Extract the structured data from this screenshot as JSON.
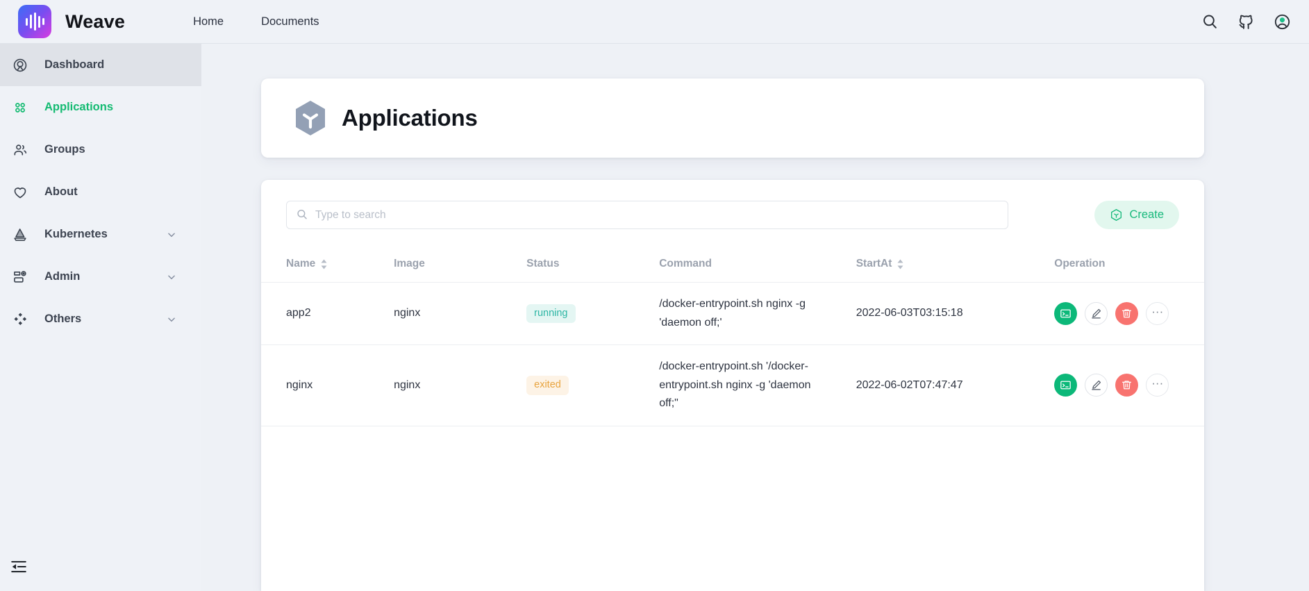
{
  "brand": {
    "name": "Weave",
    "logo_icon": "waveform-logo-icon"
  },
  "topnav": {
    "items": [
      {
        "label": "Home",
        "name": "home"
      },
      {
        "label": "Documents",
        "name": "documents"
      }
    ]
  },
  "top_icons": [
    {
      "name": "search-icon"
    },
    {
      "name": "github-icon"
    },
    {
      "name": "account-icon"
    }
  ],
  "sidebar": {
    "items": [
      {
        "label": "Dashboard",
        "icon": "dashboard-icon",
        "state": "active",
        "chevron": false
      },
      {
        "label": "Applications",
        "icon": "grid-icon",
        "state": "selected",
        "chevron": false
      },
      {
        "label": "Groups",
        "icon": "users-icon",
        "state": "normal",
        "chevron": false
      },
      {
        "label": "About",
        "icon": "heart-icon",
        "state": "normal",
        "chevron": false
      },
      {
        "label": "Kubernetes",
        "icon": "sailboat-icon",
        "state": "normal",
        "chevron": true
      },
      {
        "label": "Admin",
        "icon": "server-icon",
        "state": "normal",
        "chevron": true
      },
      {
        "label": "Others",
        "icon": "diamonds-icon",
        "state": "normal",
        "chevron": true
      }
    ],
    "collapse_icon": "menu-fold-icon"
  },
  "page": {
    "title": "Applications",
    "icon": "hexagon-cube-icon"
  },
  "search": {
    "placeholder": "Type to search",
    "value": "",
    "icon": "search-icon"
  },
  "create": {
    "label": "Create",
    "icon": "hexagon-plus-icon"
  },
  "table": {
    "columns": [
      {
        "label": "Name",
        "sortable": true
      },
      {
        "label": "Image",
        "sortable": false
      },
      {
        "label": "Status",
        "sortable": false
      },
      {
        "label": "Command",
        "sortable": false
      },
      {
        "label": "StartAt",
        "sortable": true
      },
      {
        "label": "Operation",
        "sortable": false
      }
    ],
    "rows": [
      {
        "name": "app2",
        "image": "nginx",
        "status": "running",
        "status_kind": "running",
        "command": "/docker-entrypoint.sh nginx -g 'daemon off;'",
        "start_at": "2022-06-03T03:15:18"
      },
      {
        "name": "nginx",
        "image": "nginx",
        "status": "exited",
        "status_kind": "exited",
        "command": "/docker-entrypoint.sh '/docker-entrypoint.sh nginx -g 'daemon off;\"",
        "start_at": "2022-06-02T07:47:47"
      }
    ],
    "operations": [
      {
        "name": "console",
        "icon": "terminal-icon"
      },
      {
        "name": "edit",
        "icon": "pencil-icon"
      },
      {
        "name": "delete",
        "icon": "trash-icon"
      },
      {
        "name": "more",
        "icon": "ellipsis-icon",
        "label": "···"
      }
    ]
  },
  "colors": {
    "page_bg": "#eef1f6",
    "accent_green": "#14bb72",
    "badge_running_bg": "#e4f6f3",
    "badge_running_fg": "#2cb5a4",
    "badge_exited_bg": "#fdf3e6",
    "badge_exited_fg": "#e8a33d",
    "delete_red": "#f8736f",
    "console_green": "#0cb879"
  }
}
